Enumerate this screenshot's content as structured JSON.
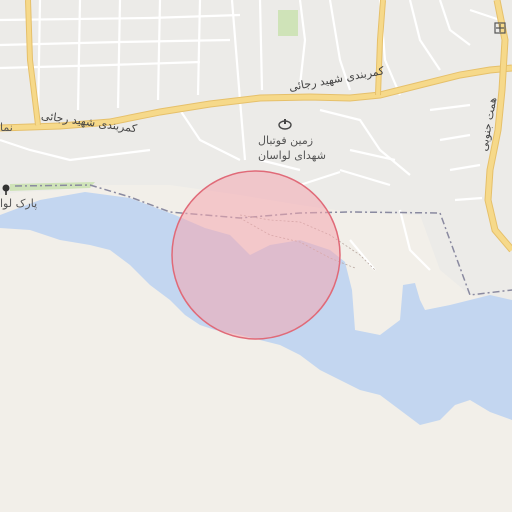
{
  "map": {
    "labels": {
      "road_upper": "کمربندی شهید رجائی",
      "road_lower": "کمربندی شهید رجائی",
      "road_vertical": "همت جنوبی",
      "stadium_line1": "زمین فوتبال",
      "stadium_line2": "شهدای لواسان",
      "park": "پارک لوا",
      "edge_label": "نما"
    },
    "icons": {
      "stadium": "stadium-icon",
      "park": "tree-icon",
      "place_of_worship": "worship-icon"
    },
    "colors": {
      "land": "#f2efe9",
      "water": "#c3d6f0",
      "road_major": "#f6d98a",
      "road_major_casing": "#e6c06a",
      "road_minor": "#ffffff",
      "boundary": "#8a8aa0",
      "highlight_fill": "#f4a8b0",
      "highlight_stroke": "#e06a78"
    }
  }
}
